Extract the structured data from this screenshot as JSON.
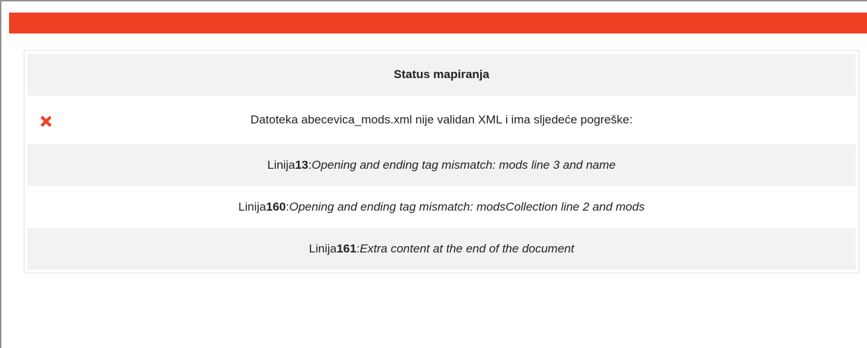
{
  "accent_color": "#ef4023",
  "status": {
    "title": "Status mapiranja",
    "message": "Datoteka abecevica_mods.xml nije validan XML i ima sljedeće pogreške:",
    "icon": "close-icon",
    "icon_color": "#ef4023"
  },
  "errors": [
    {
      "prefix": "Linija ",
      "line": "13",
      "sep": ": ",
      "text": "Opening and ending tag mismatch: mods line 3 and name"
    },
    {
      "prefix": "Linija ",
      "line": "160",
      "sep": ": ",
      "text": "Opening and ending tag mismatch: modsCollection line 2 and mods"
    },
    {
      "prefix": "Linija ",
      "line": "161",
      "sep": ": ",
      "text": "Extra content at the end of the document"
    }
  ]
}
